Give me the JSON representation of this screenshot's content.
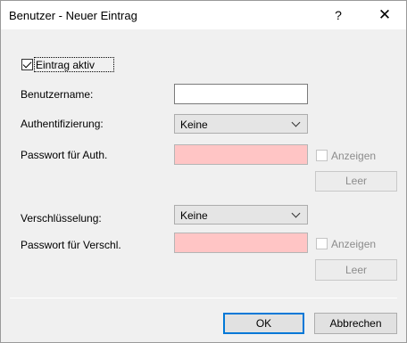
{
  "window": {
    "title": "Benutzer - Neuer Eintrag",
    "help_label": "?",
    "close_label": "✕"
  },
  "form": {
    "entry_active": {
      "label": "Eintrag aktiv",
      "checked": true
    },
    "username": {
      "label": "Benutzername:",
      "value": ""
    },
    "authentication": {
      "label": "Authentifizierung:",
      "selected": "Keine"
    },
    "auth_password": {
      "label": "Passwort für Auth.",
      "value": "",
      "show_label": "Anzeigen",
      "clear_label": "Leer"
    },
    "encryption": {
      "label": "Verschlüsselung:",
      "selected": "Keine"
    },
    "encryption_password": {
      "label": "Passwort für Verschl.",
      "value": "",
      "show_label": "Anzeigen",
      "clear_label": "Leer"
    }
  },
  "footer": {
    "ok_label": "OK",
    "cancel_label": "Abbrechen"
  },
  "colors": {
    "invalid_field": "#ffc5c5",
    "default_button_border": "#0078d7"
  }
}
